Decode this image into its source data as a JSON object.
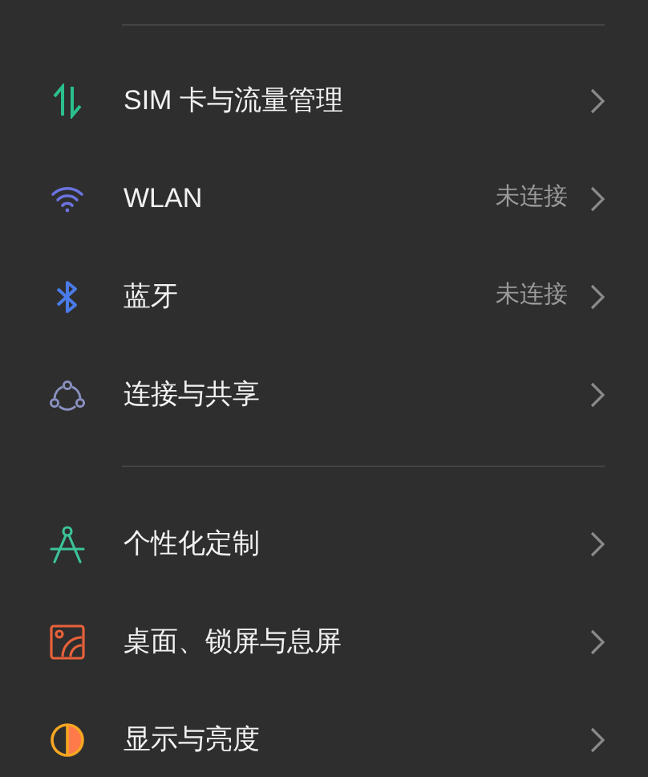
{
  "groups": [
    {
      "items": [
        {
          "kind": "sim",
          "label": "SIM 卡与流量管理"
        },
        {
          "kind": "wifi",
          "label": "WLAN",
          "value": "未连接"
        },
        {
          "kind": "bluetooth",
          "label": "蓝牙",
          "value": "未连接"
        },
        {
          "kind": "share",
          "label": "连接与共享"
        }
      ]
    },
    {
      "items": [
        {
          "kind": "compass",
          "label": "个性化定制"
        },
        {
          "kind": "wallpaper",
          "label": "桌面、锁屏与息屏"
        },
        {
          "kind": "display",
          "label": "显示与亮度"
        }
      ]
    }
  ]
}
